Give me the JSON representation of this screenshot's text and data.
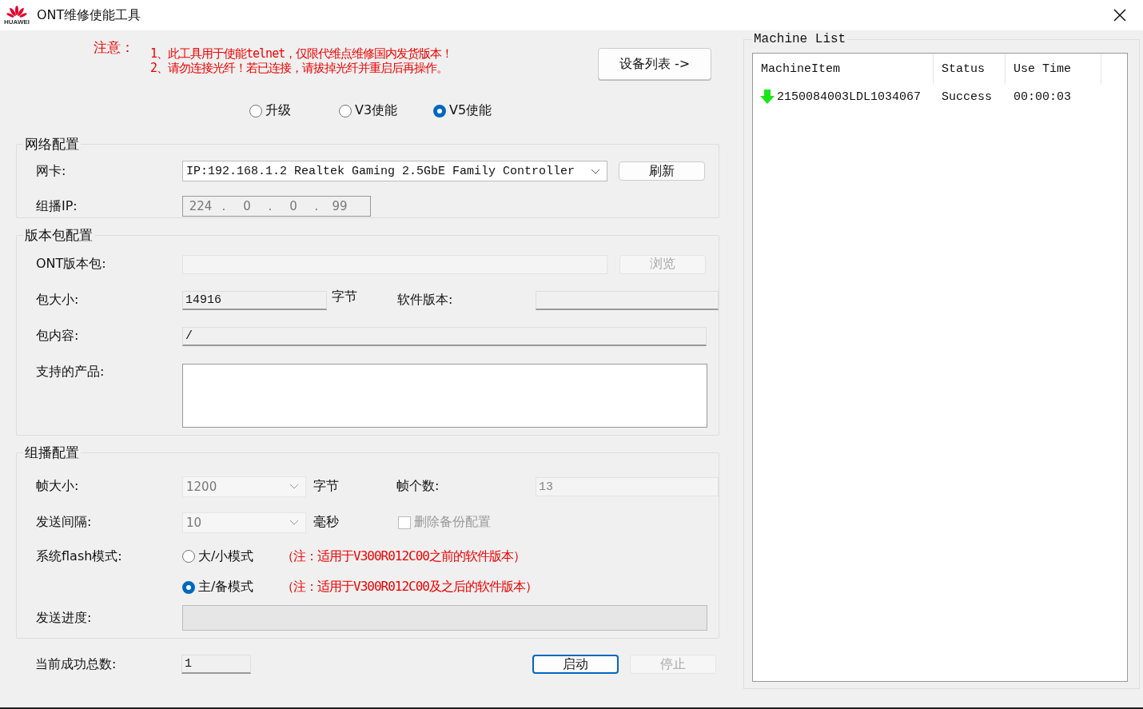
{
  "window": {
    "title": "ONT维修使能工具",
    "logo_text": "HUAWEI"
  },
  "notice": {
    "heading": "注意：",
    "lines": [
      "1、此工具用于使能telnet，仅限代维点维修国内发货版本！",
      "2、请勿连接光纤！若已连接，请拔掉光纤并重启后再操作。"
    ]
  },
  "device_list_button": "设备列表 ->",
  "modes": [
    {
      "label": "升级",
      "selected": false
    },
    {
      "label": "V3使能",
      "selected": false
    },
    {
      "label": "V5使能",
      "selected": true
    }
  ],
  "network": {
    "title": "网络配置",
    "nic_label": "网卡:",
    "nic_value": "IP:192.168.1.2 Realtek Gaming 2.5GbE Family Controller",
    "refresh": "刷新",
    "multicast_ip_label": "组播IP:",
    "multicast_ip": [
      "224",
      "0",
      "0",
      "99"
    ],
    "ip_separator": "."
  },
  "package": {
    "title": "版本包配置",
    "ont_label": "ONT版本包:",
    "browse": {
      "label": "浏览",
      "disabled": true
    },
    "size_label": "包大小:",
    "size_value": "14916",
    "size_unit": "字节",
    "sw_version_label": "软件版本:",
    "content_label": "包内容:",
    "content_value": "/",
    "products_label": "支持的产品:"
  },
  "multicast": {
    "title": "组播配置",
    "frame_size_label": "帧大小:",
    "frame_size": "1200",
    "frame_size_unit": "字节",
    "frame_count_label": "帧个数:",
    "frame_count": "13",
    "interval_label": "发送间隔:",
    "interval": "10",
    "interval_unit": "毫秒",
    "delete_backup": {
      "label": "删除备份配置",
      "checked": false,
      "disabled": true
    },
    "flash_label": "系统flash模式:",
    "flash_modes": [
      {
        "label": "大/小模式",
        "note": "（注：适用于V300R012C00之前的软件版本）",
        "selected": false
      },
      {
        "label": "主/备模式",
        "note": "（注：适用于V300R012C00及之后的软件版本）",
        "selected": true
      }
    ],
    "progress_label": "发送进度:",
    "progress": {
      "level": 0
    }
  },
  "success_label": "当前成功总数:",
  "success_count": "1",
  "buttons": [
    {
      "label": "启动",
      "disabled": false
    },
    {
      "label": "停止",
      "disabled": true
    }
  ],
  "machine_list": {
    "title": "Machine List",
    "columns": [
      "MachineItem",
      "Status",
      "Use Time"
    ],
    "rows": [
      {
        "item": "2150084003LDL1034067",
        "status": "Success",
        "use_time": "00:00:03"
      }
    ]
  }
}
